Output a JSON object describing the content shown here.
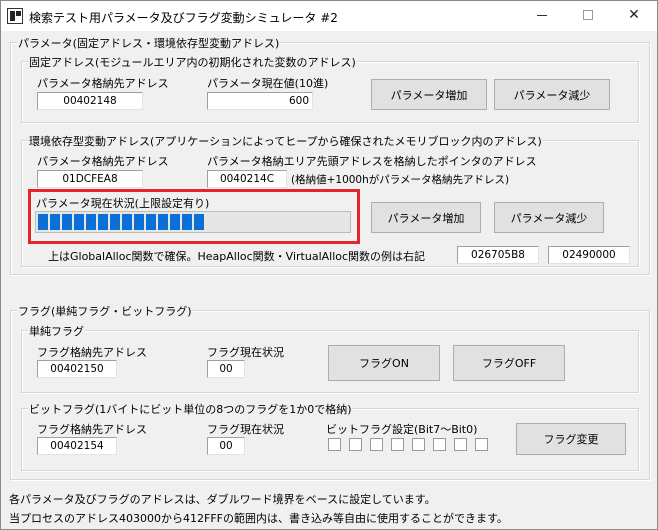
{
  "window": {
    "title": "検索テスト用パラメータ及びフラグ変動シミュレータ #2",
    "controls": {
      "minimize": "",
      "maximize": "",
      "close": "✕"
    }
  },
  "parameter_group": {
    "legend": "パラメータ(固定アドレス・環境依存型変動アドレス)",
    "fixed": {
      "legend": "固定アドレス(モジュールエリア内の初期化された変数のアドレス)",
      "address_label": "パラメータ格納先アドレス",
      "address_value": "00402148",
      "current_label": "パラメータ現在値(10進)",
      "current_value": "600",
      "increase_button": "パラメータ増加",
      "decrease_button": "パラメータ減少"
    },
    "variable": {
      "legend": "環境依存型変動アドレス(アプリケーションによってヒープから確保されたメモリブロック内のアドレス)",
      "address_label": "パラメータ格納先アドレス",
      "address_value": "01DCFEA8",
      "pointer_label": "パラメータ格納エリア先頭アドレスを格納したポインタのアドレス",
      "pointer_value": "0040214C",
      "pointer_note": "(格納値+1000hがパラメータ格納先アドレス)",
      "status_label": "パラメータ現在状況(上限設定有り)",
      "progress_percent": 55,
      "increase_button": "パラメータ増加",
      "decrease_button": "パラメータ減少",
      "alloc_note": "上はGlobalAlloc関数で確保。HeapAlloc関数・VirtualAlloc関数の例は右記",
      "heap_value": "026705B8",
      "virtual_value": "02490000"
    }
  },
  "flag_group": {
    "legend": "フラグ(単純フラグ・ビットフラグ)",
    "simple": {
      "legend": "単純フラグ",
      "address_label": "フラグ格納先アドレス",
      "address_value": "00402150",
      "status_label": "フラグ現在状況",
      "status_value": "00",
      "on_button": "フラグON",
      "off_button": "フラグOFF"
    },
    "bit": {
      "legend": "ビットフラグ(1バイトにビット単位の8つのフラグを1か0で格納)",
      "address_label": "フラグ格納先アドレス",
      "address_value": "00402154",
      "status_label": "フラグ現在状況",
      "status_value": "00",
      "bits_label": "ビットフラグ設定(Bit7〜Bit0)",
      "bits": [
        false,
        false,
        false,
        false,
        false,
        false,
        false,
        false
      ],
      "change_button": "フラグ変更"
    }
  },
  "footer": {
    "line1": "各パラメータ及びフラグのアドレスは、ダブルワード境界をベースに設定しています。",
    "line2": "当プロセスのアドレス403000から412FFFの範囲内は、書き込み等自由に使用することができます。"
  }
}
